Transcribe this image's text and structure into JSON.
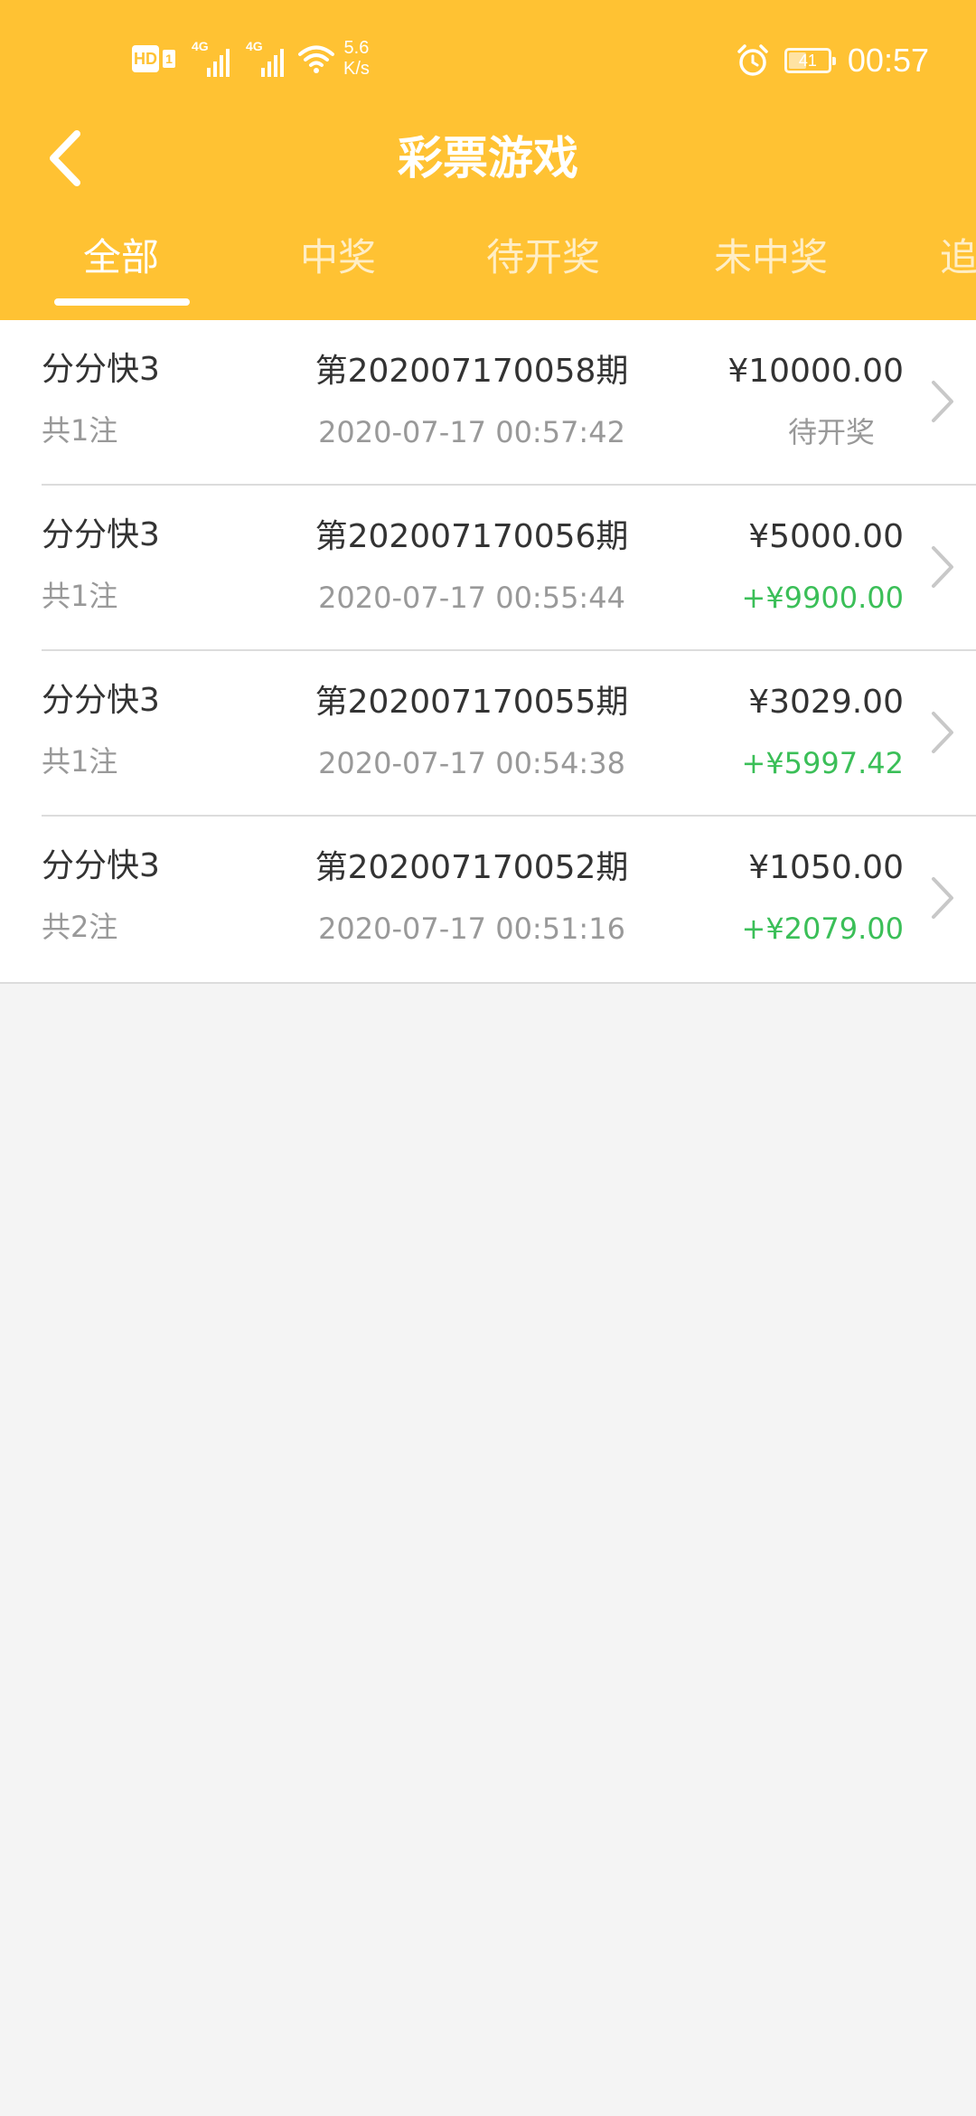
{
  "status_bar": {
    "network_badge": "HD",
    "sim_badge": "1",
    "signal1_label": "4G",
    "signal2_label": "4G",
    "net_speed_value": "5.6",
    "net_speed_unit": "K/s",
    "battery_level": "41",
    "time": "00:57"
  },
  "header": {
    "title": "彩票游戏",
    "back_icon": "chevron-left-icon"
  },
  "tabs": [
    {
      "label": "全部",
      "active": true
    },
    {
      "label": "中奖",
      "active": false
    },
    {
      "label": "待开奖",
      "active": false
    },
    {
      "label": "未中奖",
      "active": false
    },
    {
      "label": "追",
      "active": false
    }
  ],
  "records": [
    {
      "game": "分分快3",
      "bet_count": "共1注",
      "issue": "第202007170058期",
      "time": "2020-07-17 00:57:42",
      "amount": "¥10000.00",
      "result": "待开奖",
      "result_type": "pending"
    },
    {
      "game": "分分快3",
      "bet_count": "共1注",
      "issue": "第202007170056期",
      "time": "2020-07-17 00:55:44",
      "amount": "¥5000.00",
      "result": "+¥9900.00",
      "result_type": "win"
    },
    {
      "game": "分分快3",
      "bet_count": "共1注",
      "issue": "第202007170055期",
      "time": "2020-07-17 00:54:38",
      "amount": "¥3029.00",
      "result": "+¥5997.42",
      "result_type": "win"
    },
    {
      "game": "分分快3",
      "bet_count": "共2注",
      "issue": "第202007170052期",
      "time": "2020-07-17 00:51:16",
      "amount": "¥1050.00",
      "result": "+¥2079.00",
      "result_type": "win"
    }
  ],
  "colors": {
    "brand": "#ffc233",
    "win": "#3bbf58",
    "muted": "#999999",
    "text": "#333333",
    "page_bg": "#f4f4f4"
  }
}
